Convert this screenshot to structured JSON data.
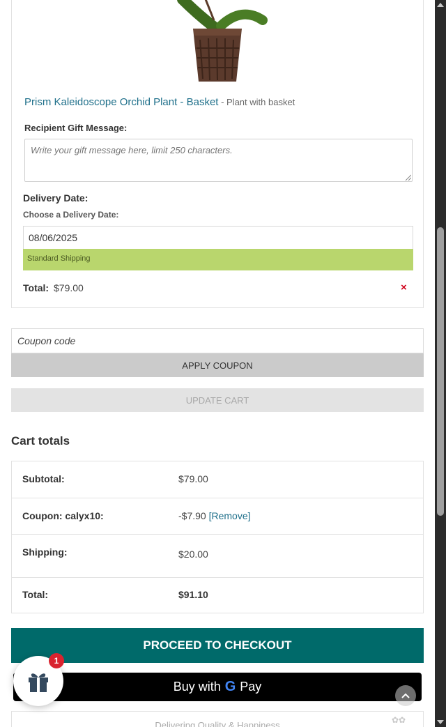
{
  "product": {
    "name": "Prism Kaleidoscope Orchid Plant - Basket",
    "variant": " - Plant with basket",
    "gift_message_label": "Recipient Gift Message:",
    "gift_message_placeholder": "Write your gift message here, limit 250 characters.",
    "delivery_date_label": "Delivery Date:",
    "delivery_date_sublabel": "Choose a Delivery Date:",
    "delivery_date_value": "08/06/2025",
    "shipping_option": "Standard Shipping",
    "total_label": "Total:",
    "total_value": "$79.00",
    "remove_symbol": "×"
  },
  "coupon": {
    "placeholder": "Coupon code",
    "apply_label": "Apply coupon",
    "update_label": "Update cart"
  },
  "cart_totals": {
    "heading": "Cart totals",
    "subtotal_label": "Subtotal:",
    "subtotal_value": "$79.00",
    "coupon_label": "Coupon: calyx10:",
    "coupon_value": "-$7.90",
    "coupon_remove": "[Remove]",
    "shipping_label": "Shipping:",
    "shipping_value": "$20.00",
    "total_label": "Total:",
    "total_value": "$91.10"
  },
  "checkout": {
    "proceed_label": "Proceed to checkout",
    "gpay_prefix": "Buy with",
    "gpay_g": "G",
    "gpay_suffix": "Pay",
    "footer_text": "Delivering Quality & Happiness"
  },
  "widgets": {
    "gift_badge_count": "1"
  },
  "colors": {
    "link": "#1e6f8a",
    "shipping_highlight": "#b9d66d",
    "checkout": "#006a6a",
    "remove": "#d0021b",
    "badge": "#d9232f"
  }
}
